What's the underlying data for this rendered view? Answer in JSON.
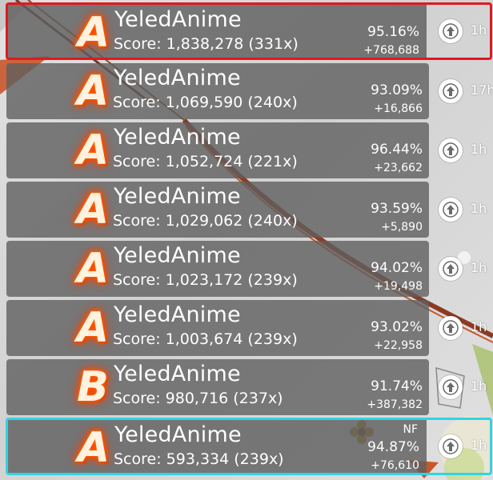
{
  "scores": [
    {
      "grade": "A",
      "player": "YeledAnime",
      "score_text": "Score: 1,838,278 (331x)",
      "accuracy": "95.16%",
      "pp": "+768,688",
      "mods": "",
      "time_ago": "1h",
      "highlight": "red"
    },
    {
      "grade": "A",
      "player": "YeledAnime",
      "score_text": "Score: 1,069,590 (240x)",
      "accuracy": "93.09%",
      "pp": "+16,866",
      "mods": "",
      "time_ago": "17h",
      "highlight": ""
    },
    {
      "grade": "A",
      "player": "YeledAnime",
      "score_text": "Score: 1,052,724 (221x)",
      "accuracy": "96.44%",
      "pp": "+23,662",
      "mods": "",
      "time_ago": "1h",
      "highlight": ""
    },
    {
      "grade": "A",
      "player": "YeledAnime",
      "score_text": "Score: 1,029,062 (240x)",
      "accuracy": "93.59%",
      "pp": "+5,890",
      "mods": "",
      "time_ago": "1h",
      "highlight": ""
    },
    {
      "grade": "A",
      "player": "YeledAnime",
      "score_text": "Score: 1,023,172 (239x)",
      "accuracy": "94.02%",
      "pp": "+19,498",
      "mods": "",
      "time_ago": "1h",
      "highlight": ""
    },
    {
      "grade": "A",
      "player": "YeledAnime",
      "score_text": "Score: 1,003,674 (239x)",
      "accuracy": "93.02%",
      "pp": "+22,958",
      "mods": "",
      "time_ago": "1h",
      "highlight": ""
    },
    {
      "grade": "B",
      "player": "YeledAnime",
      "score_text": "Score: 980,716 (237x)",
      "accuracy": "91.74%",
      "pp": "+387,382",
      "mods": "",
      "time_ago": "1h",
      "highlight": ""
    },
    {
      "grade": "A",
      "player": "YeledAnime",
      "score_text": "Score: 593,334 (239x)",
      "accuracy": "94.87%",
      "pp": "+76,610",
      "mods": "NF",
      "time_ago": "1h",
      "highlight": "cyan"
    }
  ],
  "icons": {
    "rank_change": "arrow-up-icon"
  },
  "colors": {
    "highlight_red": "#e0191f",
    "highlight_cyan": "#32d3e3",
    "grade_glow": "#ff5a00",
    "row_bg": "#5f5f5f"
  }
}
